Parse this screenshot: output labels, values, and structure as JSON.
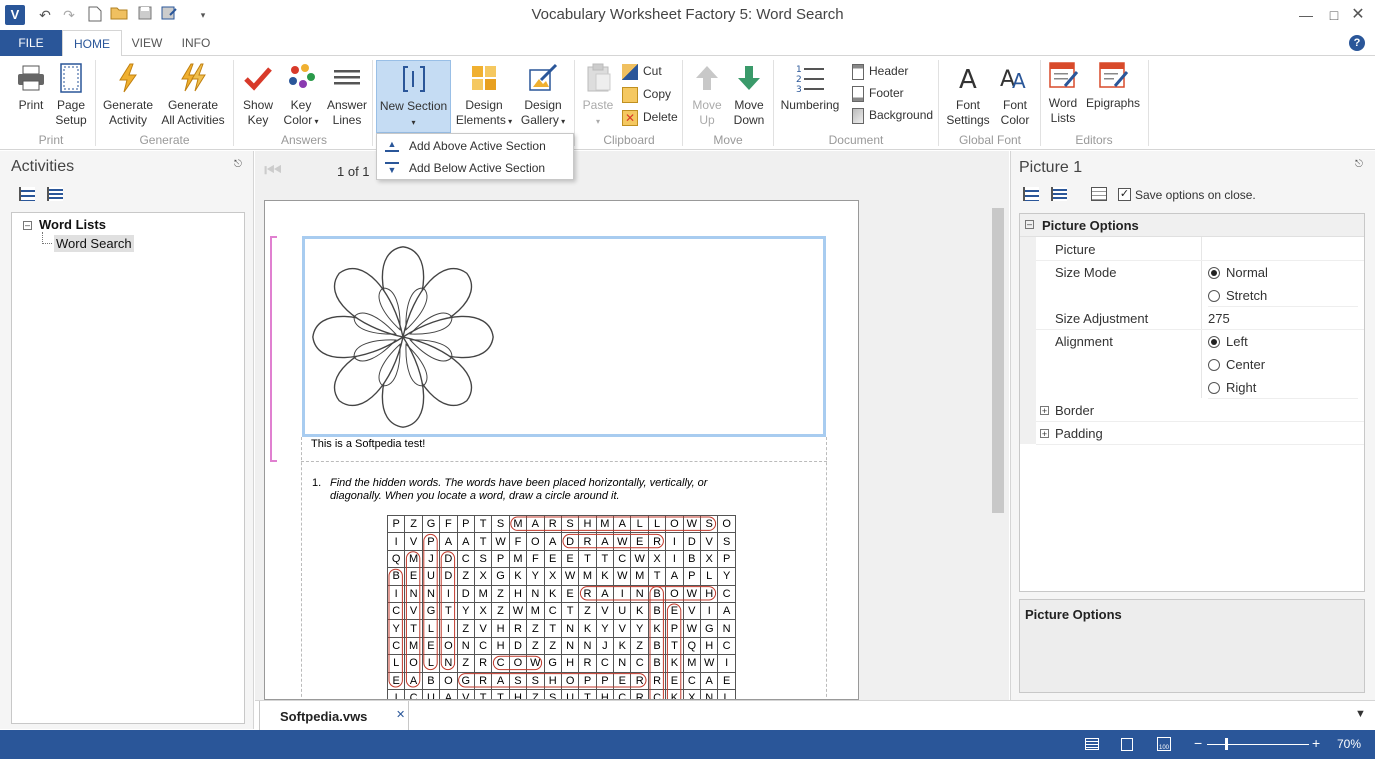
{
  "window": {
    "title": "Vocabulary Worksheet Factory 5: Word Search"
  },
  "tabs": [
    {
      "label": "FILE"
    },
    {
      "label": "HOME"
    },
    {
      "label": "VIEW"
    },
    {
      "label": "INFO"
    }
  ],
  "ribbon": {
    "print": {
      "print": "Print",
      "page_setup_1": "Page",
      "page_setup_2": "Setup",
      "group": "Print"
    },
    "generate": {
      "gen_activity_1": "Generate",
      "gen_activity_2": "Activity",
      "gen_all_1": "Generate",
      "gen_all_2": "All Activities",
      "group": "Generate"
    },
    "answers": {
      "show_key_1": "Show",
      "show_key_2": "Key",
      "key_color_1": "Key",
      "key_color_2": "Color",
      "answer_lines_1": "Answer",
      "answer_lines_2": "Lines",
      "group": "Answers"
    },
    "new_section": "New Section",
    "design_elements_1": "Design",
    "design_elements_2": "Elements",
    "design_gallery_1": "Design",
    "design_gallery_2": "Gallery",
    "clipboard": {
      "paste": "Paste",
      "cut": "Cut",
      "copy": "Copy",
      "delete": "Delete",
      "group": "Clipboard"
    },
    "move": {
      "up_1": "Move",
      "up_2": "Up",
      "down_1": "Move",
      "down_2": "Down",
      "group": "Move"
    },
    "document": {
      "numbering": "Numbering",
      "header": "Header",
      "footer": "Footer",
      "background": "Background",
      "group": "Document"
    },
    "global_font": {
      "font_settings_1": "Font",
      "font_settings_2": "Settings",
      "font_color_1": "Font",
      "font_color_2": "Color",
      "group": "Global Font"
    },
    "editors": {
      "word_lists_1": "Word",
      "word_lists_2": "Lists",
      "epigraphs": "Epigraphs",
      "group": "Editors"
    }
  },
  "new_section_menu": {
    "add_above": "Add Above Active Section",
    "add_below": "Add Below Active Section"
  },
  "activities": {
    "title": "Activities",
    "root": "Word Lists",
    "child": "Word Search"
  },
  "navigator": {
    "page_info": "1 of 1"
  },
  "worksheet": {
    "caption": "This is a Softpedia test!",
    "instr_num": "1.",
    "instr_line1": "Find the hidden words. The words have been placed horizontally, vertically, or",
    "instr_line2": "diagonally. When you locate a word, draw a circle around it.",
    "grid": [
      "PZGFPTSMARSHMALLOWSO",
      "IVPAATWFOADRAWERIDVS",
      "QMJDCSPMFEETTCWXIBXP",
      "BEUDZXGKYXWMKWMTAPLY",
      "INNIDMZHNKERAINBOWHC",
      "CVGTYXZWMCTZVUKBEVIA",
      "YTLIZVHRZTNKYVYKPWGN",
      "CMEONCHDZZNNJKZBTQHC",
      "LOLNZRCOWGHRCNCBKMWI",
      "EABOGRASSHOPPERRECAE",
      "ICUAVTTHZSUTHCRCKXNL"
    ],
    "key_color": "#c0392b"
  },
  "properties": {
    "title": "Picture 1",
    "save_on_close": "Save options on close.",
    "category": "Picture Options",
    "picture_label": "Picture",
    "size_mode_label": "Size Mode",
    "size_mode_normal": "Normal",
    "size_mode_stretch": "Stretch",
    "size_adjust_label": "Size Adjustment",
    "size_adjust_value": "275",
    "alignment_label": "Alignment",
    "align_left": "Left",
    "align_center": "Center",
    "align_right": "Right",
    "border": "Border",
    "padding": "Padding",
    "desc_title": "Picture Options"
  },
  "doc_tab": {
    "name": "Softpedia.vws"
  },
  "status": {
    "zoom": "70%"
  },
  "colors": {
    "accent": "#2a5699",
    "selection": "#c5dcf3"
  }
}
